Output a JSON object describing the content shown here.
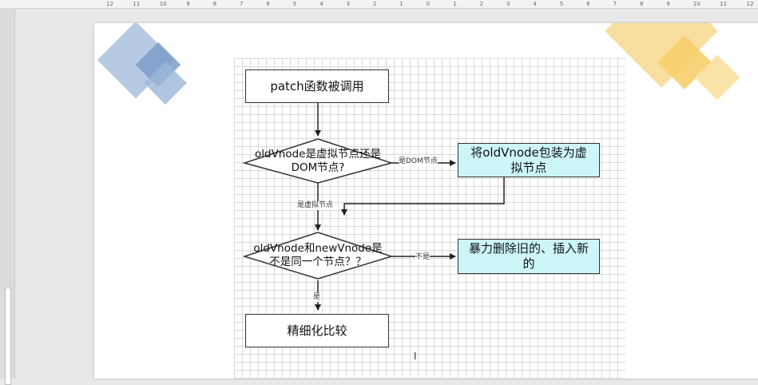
{
  "ruler": {
    "ticks": [
      "12",
      "11",
      "10",
      "9",
      "8",
      "7",
      "6",
      "5",
      "4",
      "3",
      "2",
      "1",
      "0",
      "1",
      "2",
      "3",
      "4",
      "5",
      "6",
      "7",
      "8",
      "9",
      "10",
      "11",
      "12"
    ]
  },
  "colors": {
    "deco_blue": "#8fb0d3",
    "deco_yellow": "#f5d88a",
    "process_fill": "#ffffff",
    "highlight_fill": "#cdf6f8",
    "stroke": "#333333"
  },
  "flowchart": {
    "start": "patch函数被调用",
    "decision1_line1": "oldVnode是虚拟节点还是",
    "decision1_line2": "DOM节点?",
    "edge_dom": "是DOM节点",
    "wrap_line1": "将oldVnode包装为虚",
    "wrap_line2": "拟节点",
    "edge_virtual": "是虚拟节点",
    "decision2_line1": "oldVnode和newVnode是",
    "decision2_line2": "不是同一个节点？？",
    "edge_no": "不是",
    "replace_line1": "暴力删除旧的、插入新",
    "replace_line2": "的",
    "edge_yes": "是",
    "refine": "精细化比较"
  }
}
